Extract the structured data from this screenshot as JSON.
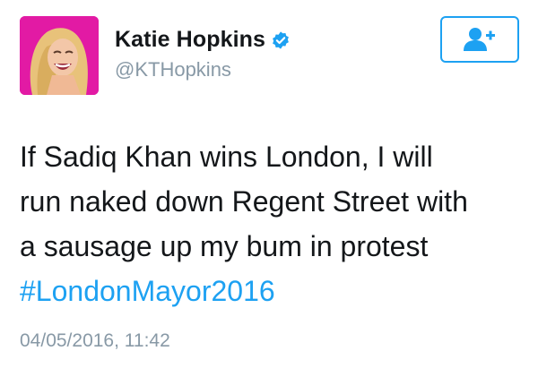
{
  "user": {
    "display_name": "Katie Hopkins",
    "handle": "@KTHopkins",
    "verified": true,
    "avatar_background": "#e21aa4"
  },
  "follow_button": {
    "icon": "add-user-icon",
    "color": "#1da1f2"
  },
  "tweet": {
    "lines": [
      "If Sadiq Khan wins London, I will",
      "run naked down Regent Street with",
      "a sausage up my bum in protest"
    ],
    "hashtag": "#LondonMayor2016",
    "timestamp": "04/05/2016, 11:42"
  },
  "colors": {
    "link": "#1da1f2",
    "muted": "#8899a6",
    "text": "#14171a"
  }
}
